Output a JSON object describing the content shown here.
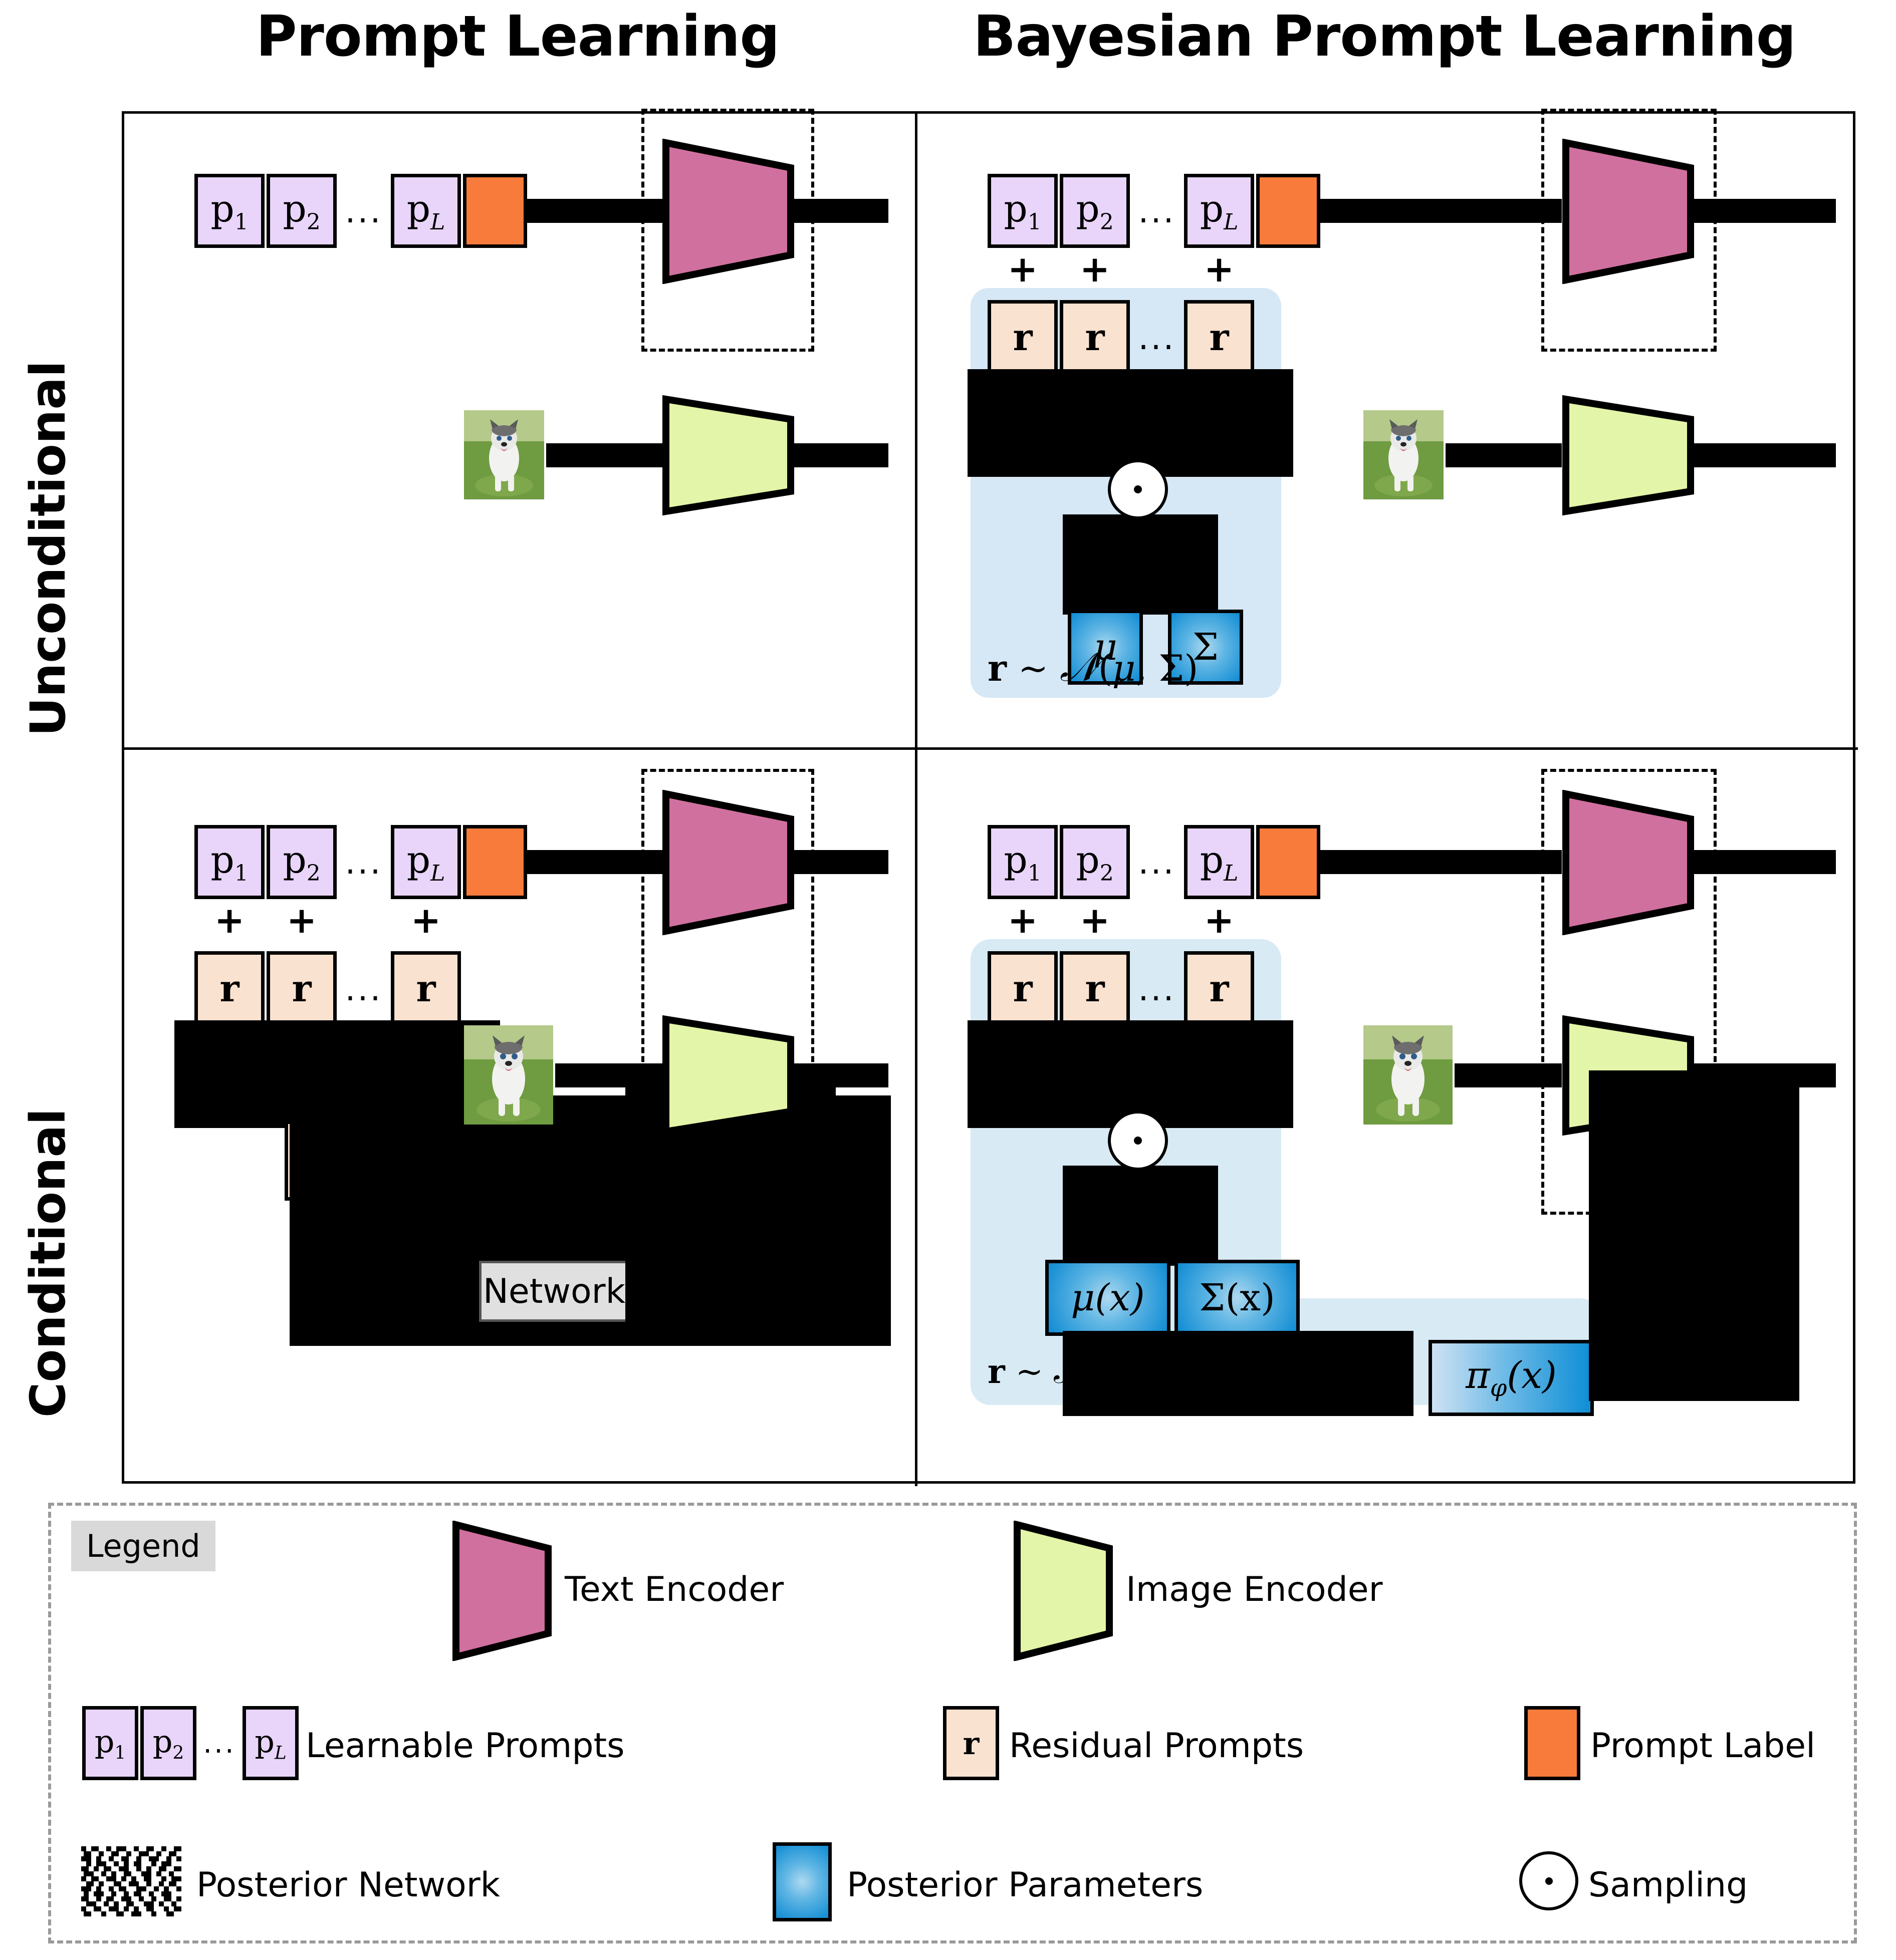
{
  "titles": {
    "left_column": "Prompt Learning",
    "right_column": "Bayesian Prompt Learning"
  },
  "row_labels": {
    "top": "Unconditional",
    "bottom": "Conditional"
  },
  "prompt_tokens": {
    "p1": "p",
    "p1_sub": "1",
    "p2": "p",
    "p2_sub": "2",
    "pL": "p",
    "pL_sub": "L",
    "ellipsis": "..."
  },
  "residual_token": "r",
  "plus_sign": "+",
  "quadrants": {
    "unconditional_prompt_learning": {
      "name": "Unconditional Prompt Learning",
      "has_residuals": false,
      "has_posterior": false
    },
    "unconditional_bayesian": {
      "name": "Unconditional Bayesian Prompt Learning",
      "mu": "μ",
      "sigma": "Σ",
      "distribution": "r ∼ 𝒩(μ, Σ)",
      "has_residuals": true,
      "has_posterior": true
    },
    "conditional_prompt_learning": {
      "name": "Conditional Prompt Learning",
      "network_label": "Network",
      "has_residuals": true,
      "has_posterior": false
    },
    "conditional_bayesian": {
      "name": "Conditional Bayesian Prompt Learning",
      "mu": "μ(x)",
      "sigma": "Σ(x)",
      "posterior_net": "πϕ(x)",
      "distribution": "r ∼ 𝒩(μ(x), Σ(x))",
      "has_residuals": true,
      "has_posterior": true
    }
  },
  "legend": {
    "title": "Legend",
    "items": [
      {
        "key": "text-encoder",
        "label": "Text Encoder",
        "icon": "trapezoid",
        "color": "#d0709e"
      },
      {
        "key": "image-encoder",
        "label": "Image Encoder",
        "icon": "trapezoid",
        "color": "#e3f5a8"
      },
      {
        "key": "learnable-prompts",
        "label": "Learnable Prompts",
        "icon": "prompt-boxes",
        "color": "#e9d5fa"
      },
      {
        "key": "residual-prompts",
        "label": "Residual Prompts",
        "icon": "square",
        "color": "#fae2d0"
      },
      {
        "key": "prompt-label",
        "label": "Prompt Label",
        "icon": "square",
        "color": "#f97b3b"
      },
      {
        "key": "posterior-network",
        "label": "Posterior Network",
        "icon": "noise-pattern",
        "color": "#000000"
      },
      {
        "key": "posterior-parameters",
        "label": "Posterior Parameters",
        "icon": "gradient-square",
        "color": "#0f8bd3"
      },
      {
        "key": "sampling",
        "label": "Sampling",
        "icon": "circle-dot",
        "color": "#ffffff"
      }
    ]
  },
  "colors": {
    "text_encoder": "#d0709e",
    "image_encoder": "#e3f5a8",
    "learnable_prompt": "#e9d5fa",
    "residual_prompt": "#fae2d0",
    "prompt_label": "#f97b3b",
    "posterior_param": "#0f8bd3",
    "posterior_region": "#d6e7f5",
    "network_box": "#e0e0e0"
  }
}
